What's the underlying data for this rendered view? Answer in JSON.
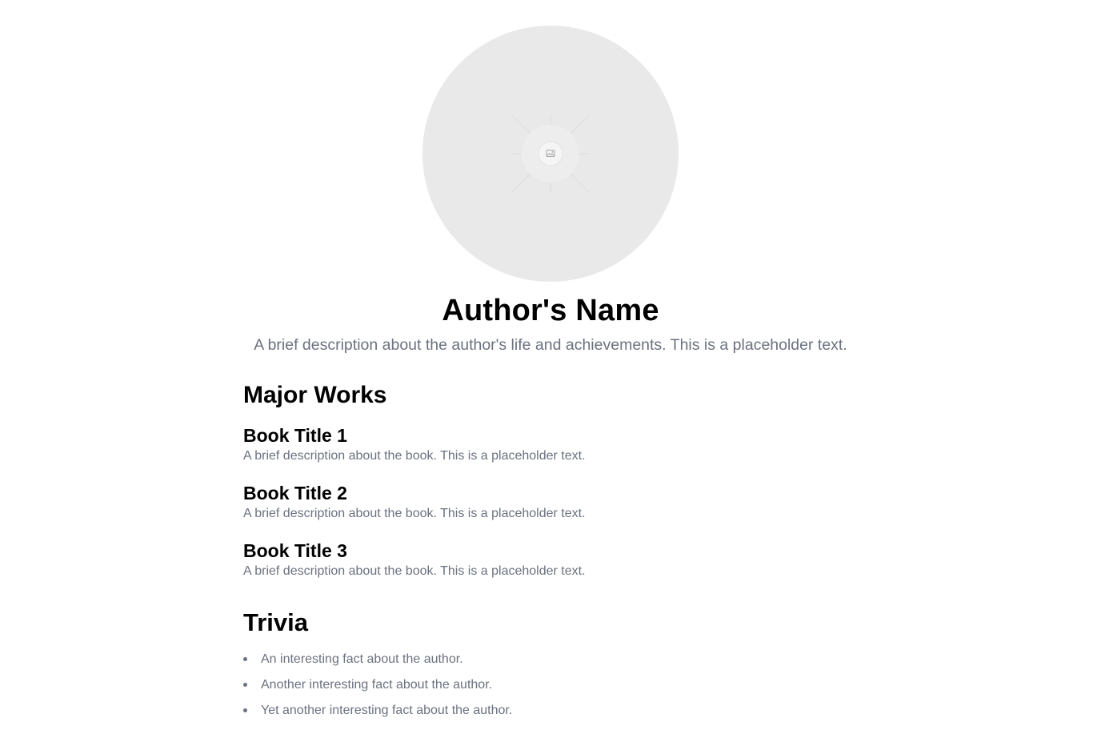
{
  "author": {
    "photo_icon": "image-placeholder-icon",
    "name": "Author's Name",
    "description": "A brief description about the author's life and achievements. This is a placeholder text."
  },
  "works": {
    "title": "Major Works",
    "books": [
      {
        "title": "Book Title 1",
        "description": "A brief description about the book. This is a placeholder text."
      },
      {
        "title": "Book Title 2",
        "description": "A brief description about the book. This is a placeholder text."
      },
      {
        "title": "Book Title 3",
        "description": "A brief description about the book. This is a placeholder text."
      }
    ]
  },
  "trivia": {
    "title": "Trivia",
    "items": [
      "An interesting fact about the author.",
      "Another interesting fact about the author.",
      "Yet another interesting fact about the author."
    ]
  },
  "colors": {
    "placeholder_bg": "#e9e9e9",
    "muted_text": "#6b7280",
    "heading_text": "#000000"
  }
}
